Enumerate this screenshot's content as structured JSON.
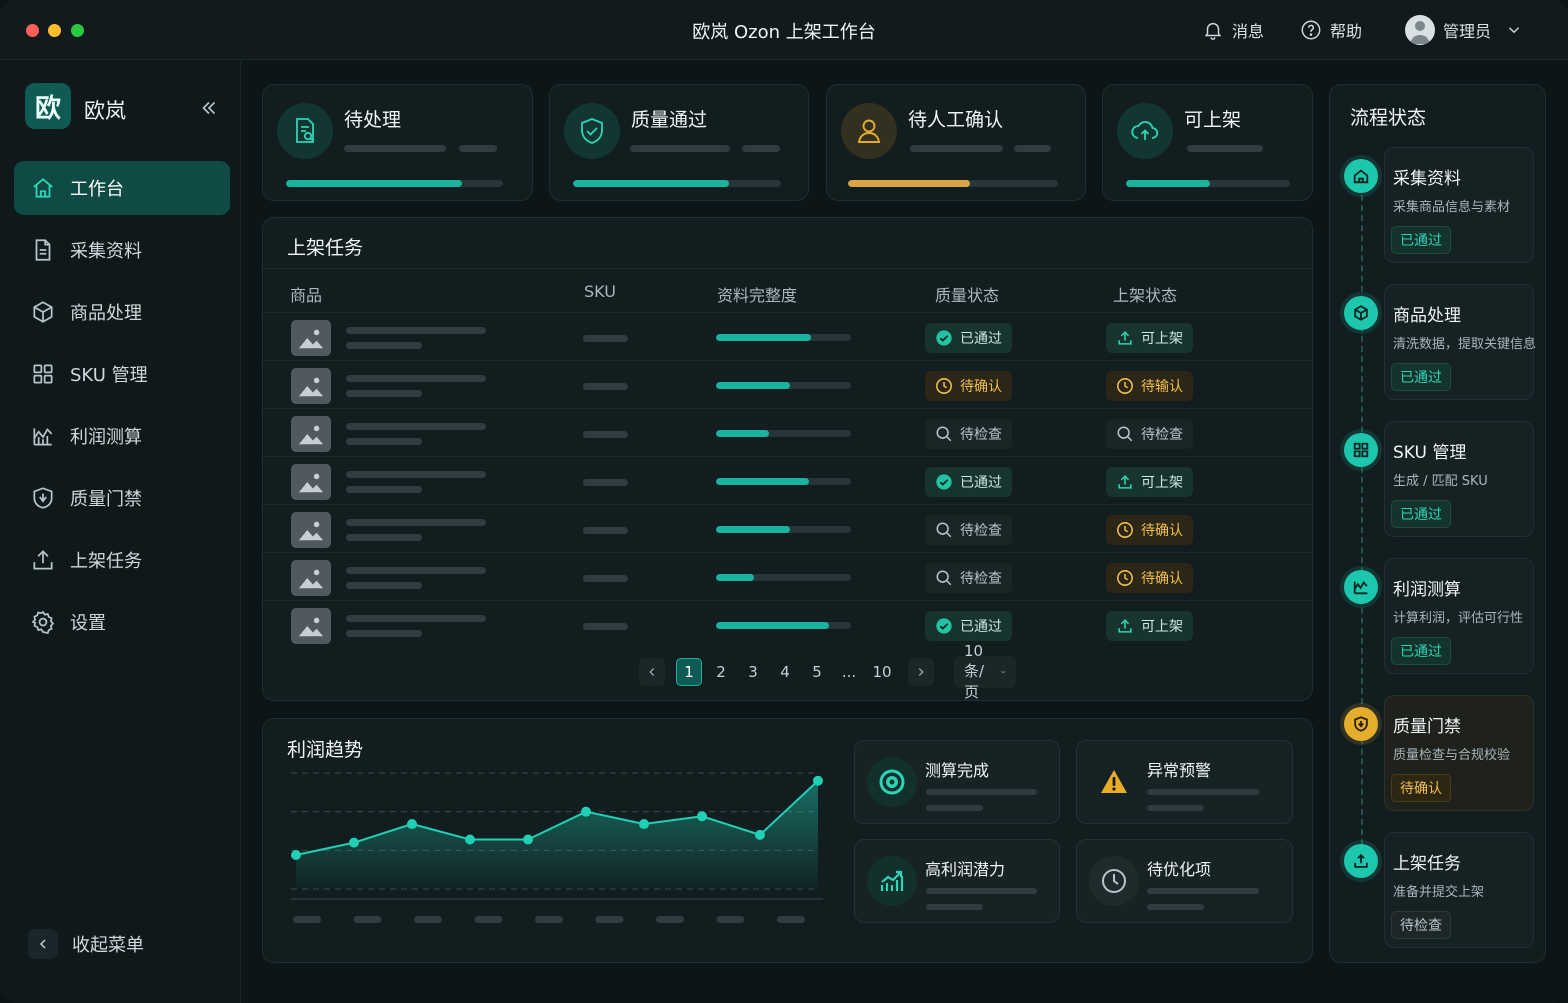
{
  "window": {
    "title": "欧岚 Ozon 上架工作台"
  },
  "topbar": {
    "messages": "消息",
    "help": "帮助",
    "user": "管理员"
  },
  "brand": {
    "logo_char": "欧",
    "name": "欧岚"
  },
  "nav": [
    {
      "label": "工作台",
      "icon": "home-icon",
      "active": true
    },
    {
      "label": "采集资料",
      "icon": "document-icon"
    },
    {
      "label": "商品处理",
      "icon": "cube-icon"
    },
    {
      "label": "SKU 管理",
      "icon": "grid-icon"
    },
    {
      "label": "利润测算",
      "icon": "chart-icon"
    },
    {
      "label": "质量门禁",
      "icon": "shield-icon"
    },
    {
      "label": "上架任务",
      "icon": "upload-icon"
    },
    {
      "label": "设置",
      "icon": "gear-icon"
    }
  ],
  "collapse_menu": "收起菜单",
  "stats": [
    {
      "title": "待处理",
      "icon": "document-search-icon",
      "progress": 0.81,
      "color": "#1bb39d"
    },
    {
      "title": "质量通过",
      "icon": "shield-check-icon",
      "progress": 0.75,
      "color": "#1bb39d"
    },
    {
      "title": "待人工确认",
      "icon": "user-icon",
      "progress": 0.58,
      "color": "#d9a441"
    },
    {
      "title": "可上架",
      "icon": "cloud-upload-icon",
      "progress": 0.51,
      "color": "#1bb39d"
    }
  ],
  "tasks": {
    "title": "上架任务",
    "columns": [
      "商品",
      "SKU",
      "资料完整度",
      "质量状态",
      "上架状态"
    ],
    "rows": [
      {
        "completeness": 0.7,
        "quality": "已通过",
        "q_type": "ok",
        "listing": "可上架",
        "l_type": "up"
      },
      {
        "completeness": 0.55,
        "quality": "待确认",
        "q_type": "wait",
        "listing": "待输认",
        "l_type": "wait"
      },
      {
        "completeness": 0.39,
        "quality": "待检查",
        "q_type": "check",
        "listing": "待检查",
        "l_type": "check"
      },
      {
        "completeness": 0.69,
        "quality": "已通过",
        "q_type": "ok",
        "listing": "可上架",
        "l_type": "up"
      },
      {
        "completeness": 0.55,
        "quality": "待检查",
        "q_type": "check",
        "listing": "待确认",
        "l_type": "wait"
      },
      {
        "completeness": 0.28,
        "quality": "待检查",
        "q_type": "check",
        "listing": "待确认",
        "l_type": "wait"
      },
      {
        "completeness": 0.84,
        "quality": "已通过",
        "q_type": "ok",
        "listing": "可上架",
        "l_type": "up"
      }
    ],
    "pagination": {
      "pages": [
        "1",
        "2",
        "3",
        "4",
        "5",
        "...",
        "10"
      ],
      "current": "1",
      "per_page": "10 条/页"
    }
  },
  "profit": {
    "title": "利润趋势"
  },
  "chart_data": {
    "type": "area",
    "title": "利润趋势",
    "values": [
      22,
      30,
      42,
      32,
      32,
      50,
      42,
      47,
      35,
      70
    ],
    "ylim": [
      0,
      75
    ],
    "grid": true,
    "color": "#1fd0b4"
  },
  "mini_cards": [
    {
      "title": "测算完成",
      "icon": "target-icon"
    },
    {
      "title": "异常预警",
      "icon": "warning-icon"
    },
    {
      "title": "高利润潜力",
      "icon": "trend-up-icon"
    },
    {
      "title": "待优化项",
      "icon": "clock-icon"
    }
  ],
  "flow": {
    "title": "流程状态",
    "steps": [
      {
        "title": "采集资料",
        "desc": "采集商品信息与素材",
        "status": "已通过",
        "type": "ok",
        "icon": "home-icon"
      },
      {
        "title": "商品处理",
        "desc": "清洗数据，提取关键信息",
        "status": "已通过",
        "type": "ok",
        "icon": "cube-icon"
      },
      {
        "title": "SKU 管理",
        "desc": "生成 / 匹配 SKU",
        "status": "已通过",
        "type": "ok",
        "icon": "grid-icon"
      },
      {
        "title": "利润测算",
        "desc": "计算利润，评估可行性",
        "status": "已通过",
        "type": "ok",
        "icon": "chart-icon"
      },
      {
        "title": "质量门禁",
        "desc": "质量检查与合规校验",
        "status": "待确认",
        "type": "wait",
        "icon": "shield-icon"
      },
      {
        "title": "上架任务",
        "desc": "准备并提交上架",
        "status": "待检查",
        "type": "check",
        "icon": "upload-icon"
      }
    ]
  }
}
